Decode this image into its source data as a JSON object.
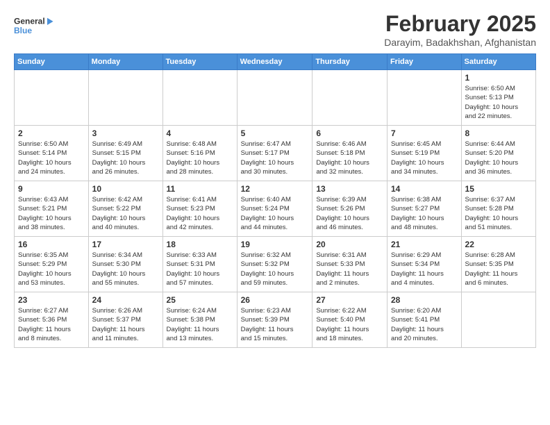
{
  "logo": {
    "general": "General",
    "blue": "Blue"
  },
  "title": "February 2025",
  "subtitle": "Darayim, Badakhshan, Afghanistan",
  "weekdays": [
    "Sunday",
    "Monday",
    "Tuesday",
    "Wednesday",
    "Thursday",
    "Friday",
    "Saturday"
  ],
  "weeks": [
    [
      {
        "day": "",
        "info": ""
      },
      {
        "day": "",
        "info": ""
      },
      {
        "day": "",
        "info": ""
      },
      {
        "day": "",
        "info": ""
      },
      {
        "day": "",
        "info": ""
      },
      {
        "day": "",
        "info": ""
      },
      {
        "day": "1",
        "info": "Sunrise: 6:50 AM\nSunset: 5:13 PM\nDaylight: 10 hours\nand 22 minutes."
      }
    ],
    [
      {
        "day": "2",
        "info": "Sunrise: 6:50 AM\nSunset: 5:14 PM\nDaylight: 10 hours\nand 24 minutes."
      },
      {
        "day": "3",
        "info": "Sunrise: 6:49 AM\nSunset: 5:15 PM\nDaylight: 10 hours\nand 26 minutes."
      },
      {
        "day": "4",
        "info": "Sunrise: 6:48 AM\nSunset: 5:16 PM\nDaylight: 10 hours\nand 28 minutes."
      },
      {
        "day": "5",
        "info": "Sunrise: 6:47 AM\nSunset: 5:17 PM\nDaylight: 10 hours\nand 30 minutes."
      },
      {
        "day": "6",
        "info": "Sunrise: 6:46 AM\nSunset: 5:18 PM\nDaylight: 10 hours\nand 32 minutes."
      },
      {
        "day": "7",
        "info": "Sunrise: 6:45 AM\nSunset: 5:19 PM\nDaylight: 10 hours\nand 34 minutes."
      },
      {
        "day": "8",
        "info": "Sunrise: 6:44 AM\nSunset: 5:20 PM\nDaylight: 10 hours\nand 36 minutes."
      }
    ],
    [
      {
        "day": "9",
        "info": "Sunrise: 6:43 AM\nSunset: 5:21 PM\nDaylight: 10 hours\nand 38 minutes."
      },
      {
        "day": "10",
        "info": "Sunrise: 6:42 AM\nSunset: 5:22 PM\nDaylight: 10 hours\nand 40 minutes."
      },
      {
        "day": "11",
        "info": "Sunrise: 6:41 AM\nSunset: 5:23 PM\nDaylight: 10 hours\nand 42 minutes."
      },
      {
        "day": "12",
        "info": "Sunrise: 6:40 AM\nSunset: 5:24 PM\nDaylight: 10 hours\nand 44 minutes."
      },
      {
        "day": "13",
        "info": "Sunrise: 6:39 AM\nSunset: 5:26 PM\nDaylight: 10 hours\nand 46 minutes."
      },
      {
        "day": "14",
        "info": "Sunrise: 6:38 AM\nSunset: 5:27 PM\nDaylight: 10 hours\nand 48 minutes."
      },
      {
        "day": "15",
        "info": "Sunrise: 6:37 AM\nSunset: 5:28 PM\nDaylight: 10 hours\nand 51 minutes."
      }
    ],
    [
      {
        "day": "16",
        "info": "Sunrise: 6:35 AM\nSunset: 5:29 PM\nDaylight: 10 hours\nand 53 minutes."
      },
      {
        "day": "17",
        "info": "Sunrise: 6:34 AM\nSunset: 5:30 PM\nDaylight: 10 hours\nand 55 minutes."
      },
      {
        "day": "18",
        "info": "Sunrise: 6:33 AM\nSunset: 5:31 PM\nDaylight: 10 hours\nand 57 minutes."
      },
      {
        "day": "19",
        "info": "Sunrise: 6:32 AM\nSunset: 5:32 PM\nDaylight: 10 hours\nand 59 minutes."
      },
      {
        "day": "20",
        "info": "Sunrise: 6:31 AM\nSunset: 5:33 PM\nDaylight: 11 hours\nand 2 minutes."
      },
      {
        "day": "21",
        "info": "Sunrise: 6:29 AM\nSunset: 5:34 PM\nDaylight: 11 hours\nand 4 minutes."
      },
      {
        "day": "22",
        "info": "Sunrise: 6:28 AM\nSunset: 5:35 PM\nDaylight: 11 hours\nand 6 minutes."
      }
    ],
    [
      {
        "day": "23",
        "info": "Sunrise: 6:27 AM\nSunset: 5:36 PM\nDaylight: 11 hours\nand 8 minutes."
      },
      {
        "day": "24",
        "info": "Sunrise: 6:26 AM\nSunset: 5:37 PM\nDaylight: 11 hours\nand 11 minutes."
      },
      {
        "day": "25",
        "info": "Sunrise: 6:24 AM\nSunset: 5:38 PM\nDaylight: 11 hours\nand 13 minutes."
      },
      {
        "day": "26",
        "info": "Sunrise: 6:23 AM\nSunset: 5:39 PM\nDaylight: 11 hours\nand 15 minutes."
      },
      {
        "day": "27",
        "info": "Sunrise: 6:22 AM\nSunset: 5:40 PM\nDaylight: 11 hours\nand 18 minutes."
      },
      {
        "day": "28",
        "info": "Sunrise: 6:20 AM\nSunset: 5:41 PM\nDaylight: 11 hours\nand 20 minutes."
      },
      {
        "day": "",
        "info": ""
      }
    ]
  ]
}
